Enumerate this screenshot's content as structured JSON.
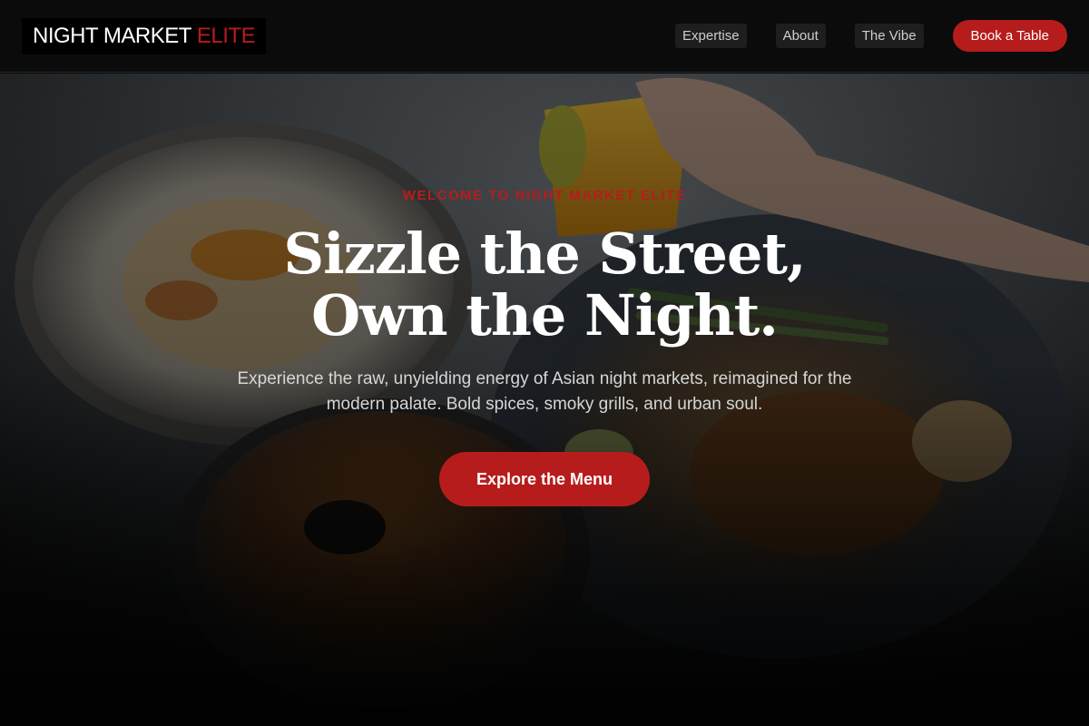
{
  "brand": {
    "name_primary": "NIGHT MARKET",
    "name_accent": "ELITE"
  },
  "nav": {
    "items": [
      {
        "label": "Expertise"
      },
      {
        "label": "About"
      },
      {
        "label": "The Vibe"
      }
    ],
    "cta_label": "Book a Table"
  },
  "hero": {
    "eyebrow": "WELCOME TO NIGHT MARKET ELITE",
    "headline_line1": "Sizzle the Street,",
    "headline_line2": "Own the Night.",
    "subtext": "Experience the raw, unyielding energy of Asian night markets, reimagined for the modern palate. Bold spices, smoky grills, and urban soul.",
    "button_label": "Explore the Menu"
  },
  "colors": {
    "accent": "#b71c1c",
    "header_bg": "#0b0b0b",
    "text_primary": "#ffffff",
    "text_secondary": "#d6d6d6"
  }
}
